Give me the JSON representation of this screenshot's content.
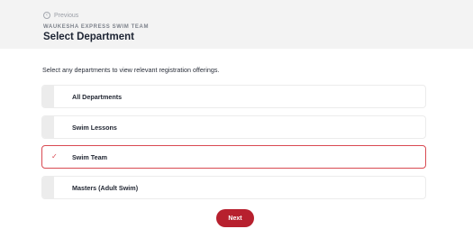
{
  "header": {
    "previous_label": "Previous",
    "org_name": "WAUKESHA EXPRESS SWIM TEAM",
    "title": "Select Department"
  },
  "main": {
    "instruction": "Select any departments to view relevant registration offerings.",
    "options": [
      {
        "label": "All Departments",
        "selected": false
      },
      {
        "label": "Swim Lessons",
        "selected": false
      },
      {
        "label": "Swim Team",
        "selected": true
      },
      {
        "label": "Masters (Adult Swim)",
        "selected": false
      }
    ],
    "next_label": "Next",
    "accent_color": "#b7202e",
    "selected_border_color": "#d94a52"
  }
}
